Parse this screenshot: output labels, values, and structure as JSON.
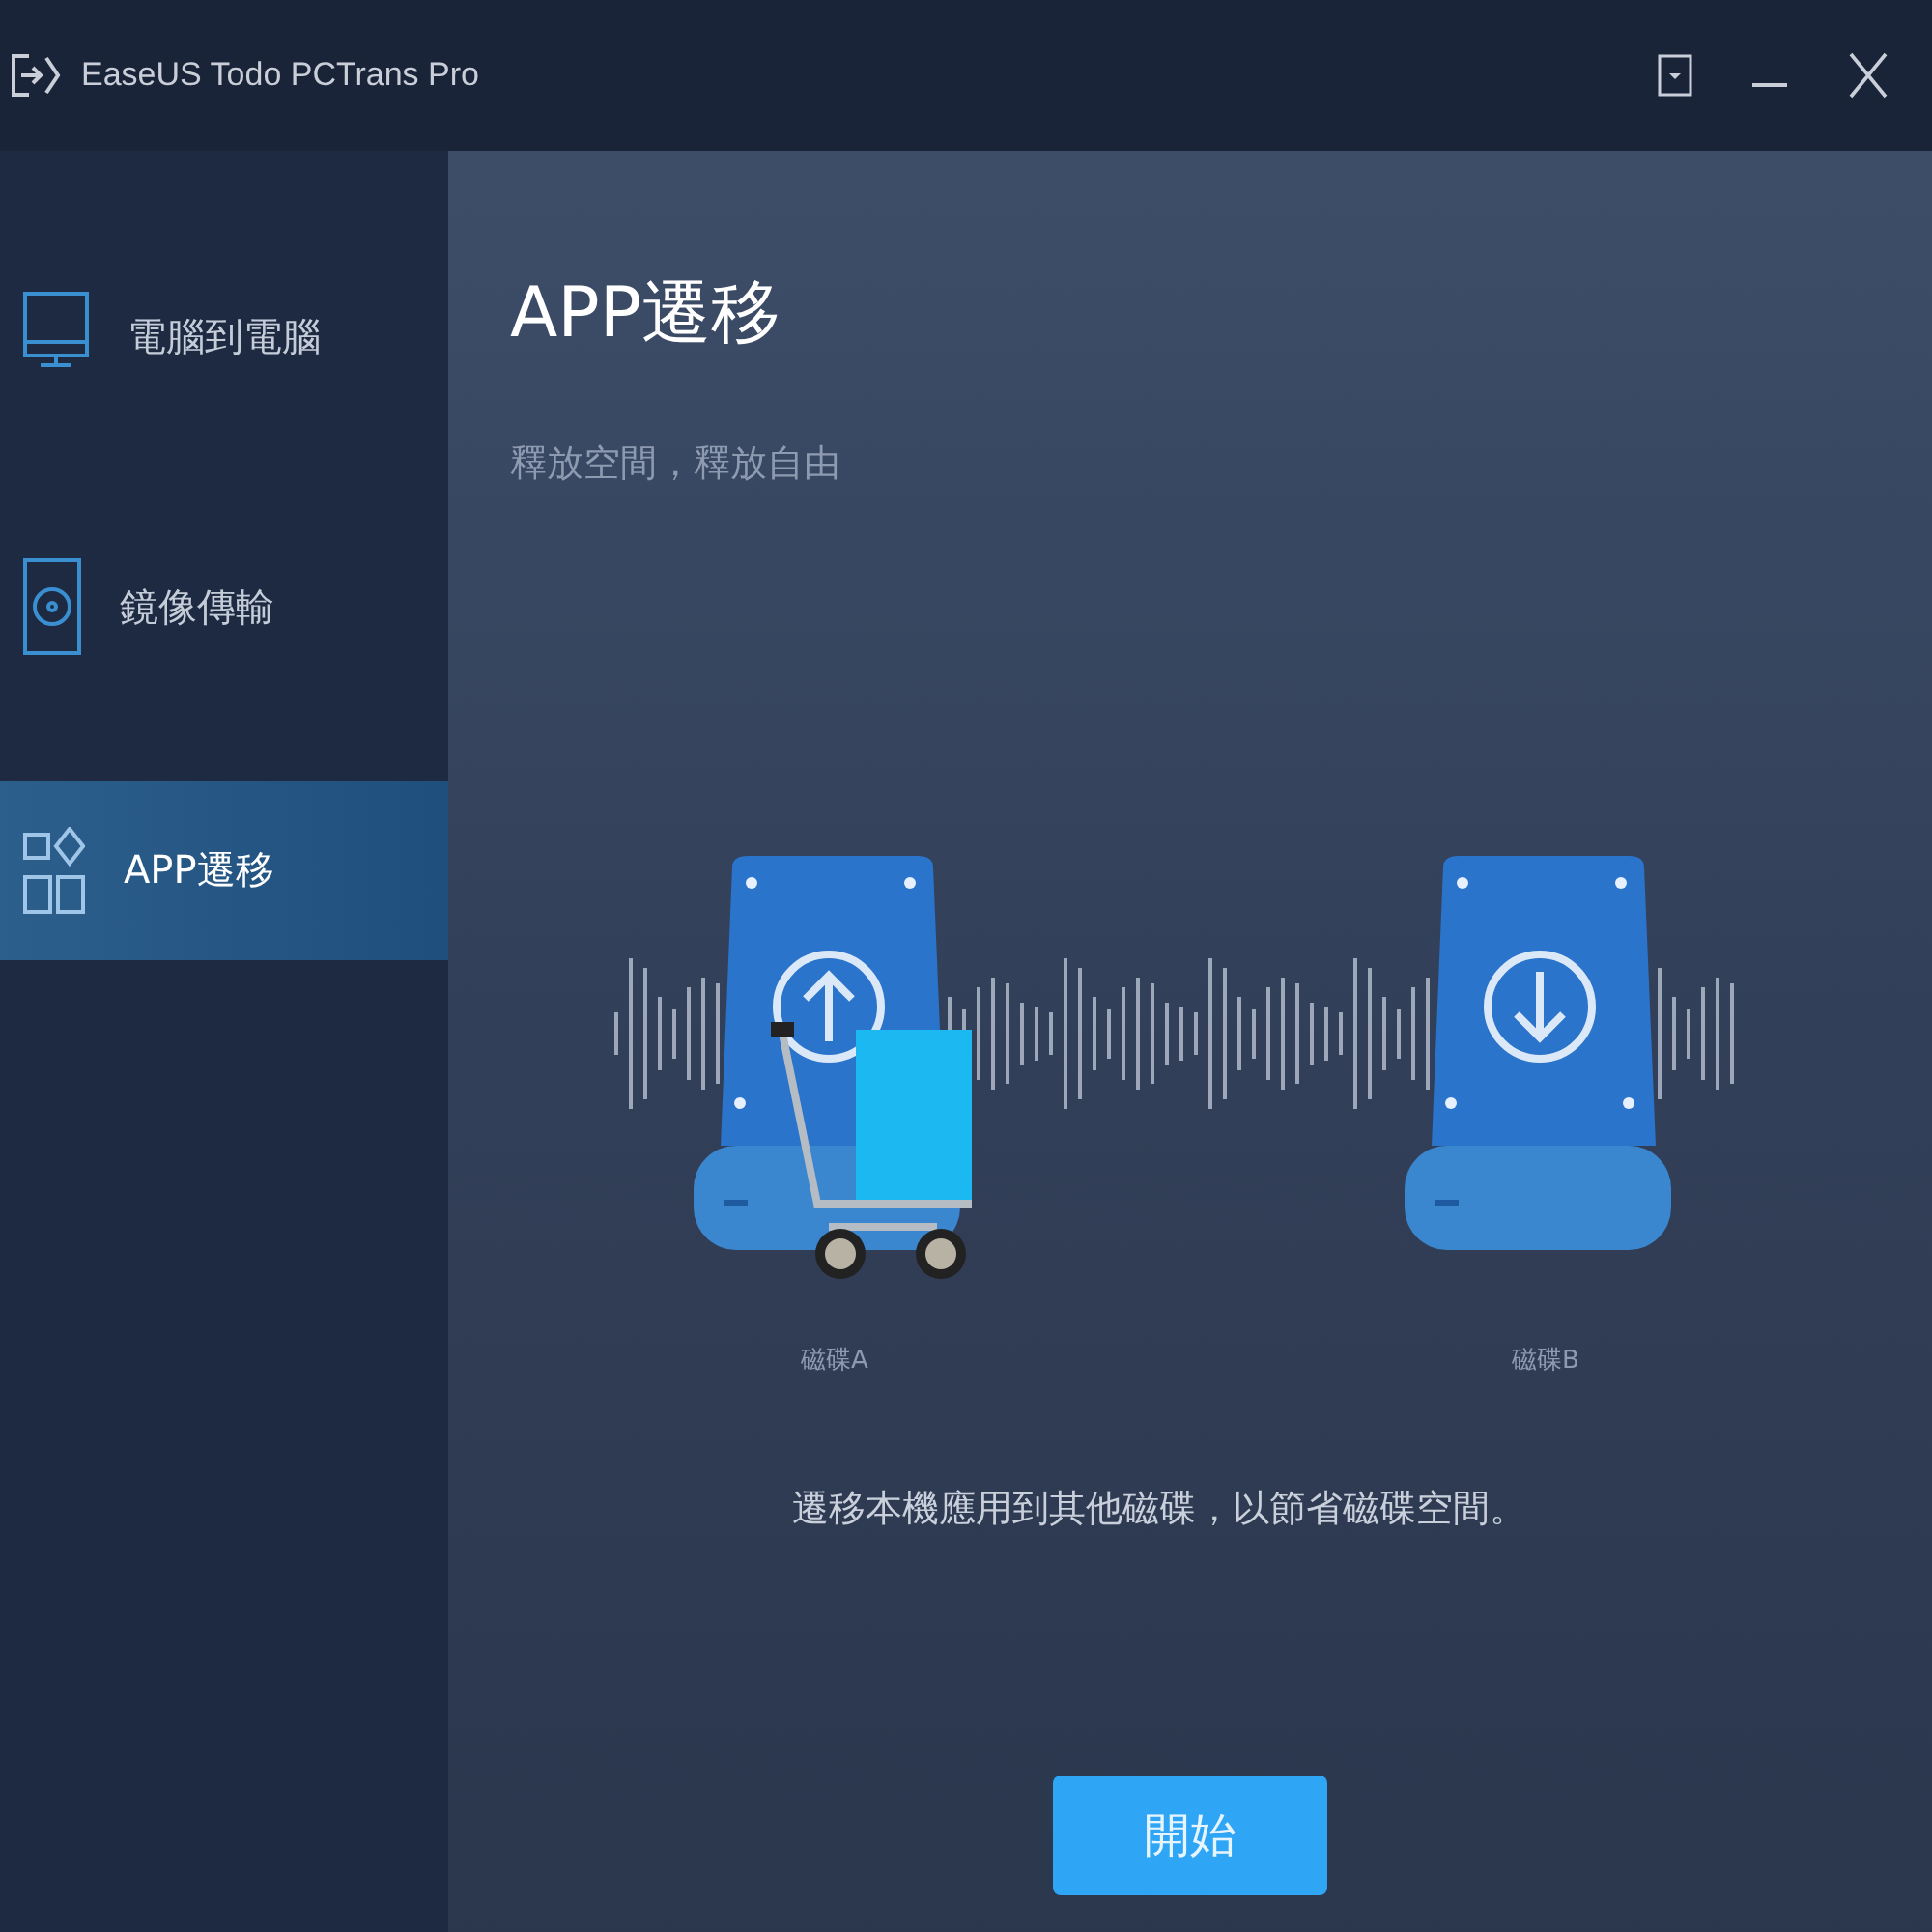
{
  "window": {
    "title": "EaseUS Todo PCTrans Pro"
  },
  "sidebar": {
    "items": [
      {
        "label": "電腦到電腦",
        "selected": false
      },
      {
        "label": "鏡像傳輸",
        "selected": false
      },
      {
        "label": "APP遷移",
        "selected": true
      }
    ]
  },
  "main": {
    "title": "APP遷移",
    "subtitle": "釋放空間，釋放自由",
    "drives": [
      {
        "kind": "source",
        "label": "磁碟A"
      },
      {
        "kind": "target",
        "label": "磁碟B"
      }
    ],
    "description": "遷移本機應用到其他磁碟，以節省磁碟空間。",
    "start_button": "開始"
  }
}
